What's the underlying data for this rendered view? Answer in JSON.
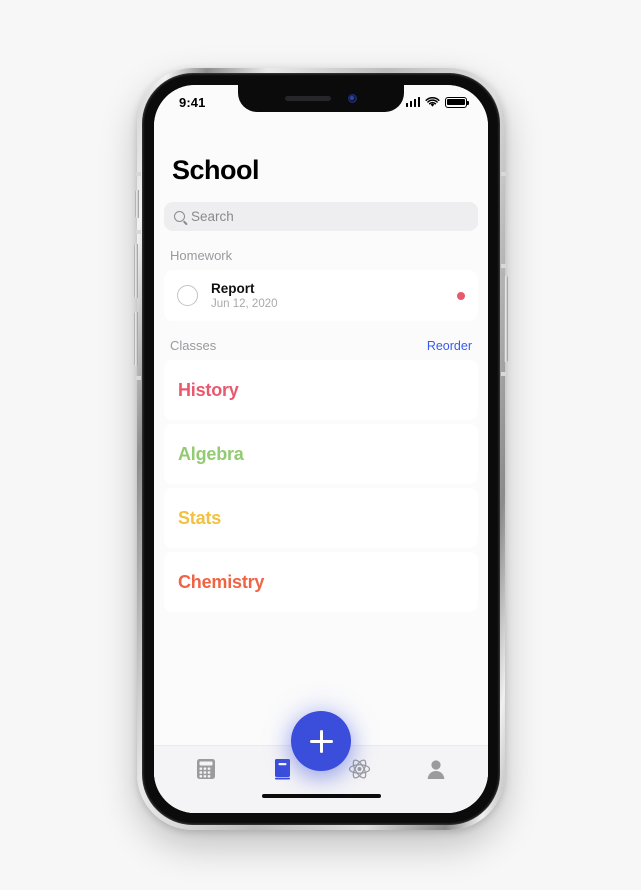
{
  "device": {
    "name": "iphone-x",
    "frame_color": "#cfcfcf",
    "bezel_color": "#0b0b0c"
  },
  "status_bar": {
    "time": "9:41",
    "signal_icon": "cellular-signal-icon",
    "wifi_icon": "wifi-icon",
    "battery_icon": "battery-icon"
  },
  "app": {
    "title": "School",
    "background": "#fbfbfb"
  },
  "search": {
    "placeholder": "Search",
    "icon": "search-icon"
  },
  "homework": {
    "section_title": "Homework",
    "items": [
      {
        "title": "Report",
        "date": "Jun 12, 2020",
        "checked": false,
        "dot_color": "#e8596e"
      }
    ]
  },
  "classes": {
    "section_title": "Classes",
    "action_label": "Reorder",
    "action_color": "#3a5bf0",
    "items": [
      {
        "name": "History",
        "color": "#e8596e"
      },
      {
        "name": "Algebra",
        "color": "#93cb71"
      },
      {
        "name": "Stats",
        "color": "#f0c143"
      },
      {
        "name": "Chemistry",
        "color": "#ef6444"
      }
    ]
  },
  "fab": {
    "label": "+",
    "name": "add-button",
    "color": "#3b4ddb"
  },
  "tab_bar": {
    "active_color": "#3b4ddb",
    "inactive_color": "#9b9b9f",
    "tabs": [
      {
        "name": "calculator-icon",
        "label": "Calculator",
        "active": false
      },
      {
        "name": "book-icon",
        "label": "Classes",
        "active": true
      },
      {
        "name": "atom-icon",
        "label": "Science",
        "active": false
      },
      {
        "name": "person-icon",
        "label": "Profile",
        "active": false
      }
    ]
  }
}
